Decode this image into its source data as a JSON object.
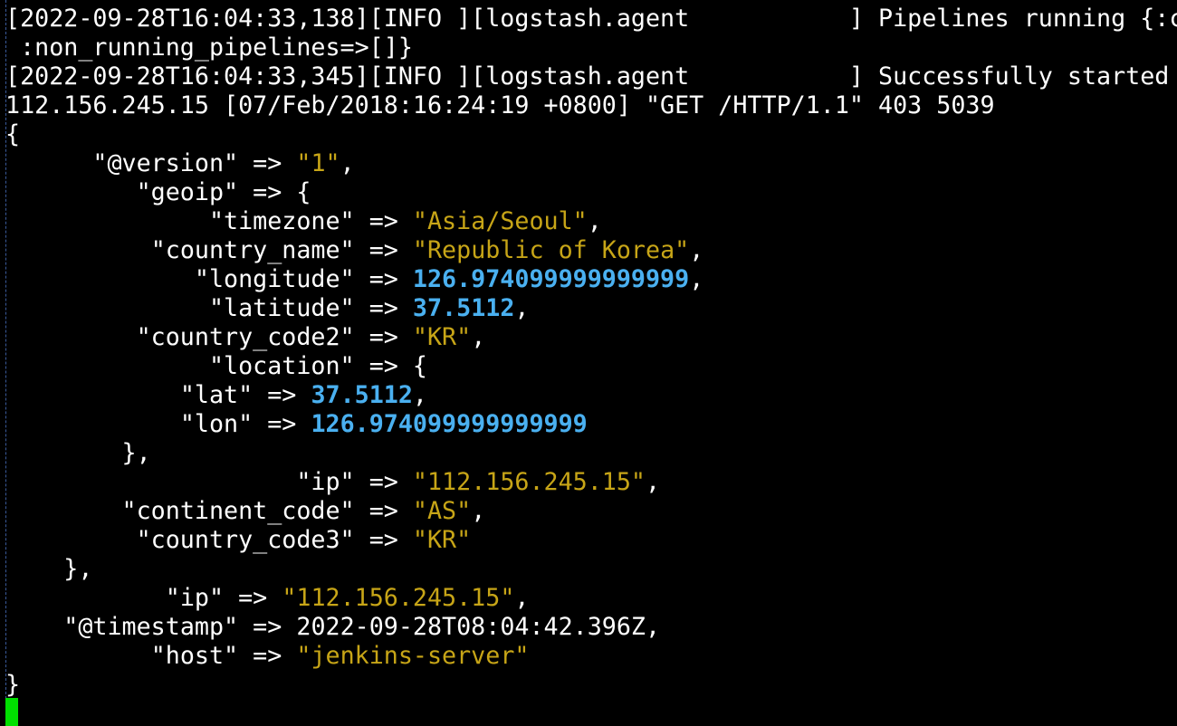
{
  "terminal": {
    "log_lines": [
      "[2022-09-28T16:04:33,138][INFO ][logstash.agent           ] Pipelines running {:c",
      " :non_running_pipelines=>[]}",
      "[2022-09-28T16:04:33,345][INFO ][logstash.agent           ] Successfully started",
      "112.156.245.15 [07/Feb/2018:16:24:19 +0800] \"GET /HTTP/1.1\" 403 5039"
    ],
    "open_brace": "{",
    "close_brace": "}",
    "arrow": " => ",
    "geoip_close": "},",
    "location_close": "},",
    "rubydebug": [
      {
        "indent": "      ",
        "key": "\"@version\"",
        "value": "\"1\"",
        "type": "str",
        "suffix": ","
      },
      {
        "indent": "         ",
        "key": "\"geoip\"",
        "value": "{",
        "type": "plain",
        "suffix": ""
      },
      {
        "indent": "              ",
        "key": "\"timezone\"",
        "value": "\"Asia/Seoul\"",
        "type": "str",
        "suffix": ","
      },
      {
        "indent": "          ",
        "key": "\"country_name\"",
        "value": "\"Republic of Korea\"",
        "type": "str",
        "suffix": ","
      },
      {
        "indent": "             ",
        "key": "\"longitude\"",
        "value": "126.974099999999999",
        "type": "num",
        "suffix": ","
      },
      {
        "indent": "              ",
        "key": "\"latitude\"",
        "value": "37.5112",
        "type": "num",
        "suffix": ","
      },
      {
        "indent": "         ",
        "key": "\"country_code2\"",
        "value": "\"KR\"",
        "type": "str",
        "suffix": ","
      },
      {
        "indent": "              ",
        "key": "\"location\"",
        "value": "{",
        "type": "plain",
        "suffix": ""
      },
      {
        "indent": "            ",
        "key": "\"lat\"",
        "value": "37.5112",
        "type": "num",
        "suffix": ","
      },
      {
        "indent": "            ",
        "key": "\"lon\"",
        "value": "126.974099999999999",
        "type": "num",
        "suffix": ""
      },
      {
        "indent": "        ",
        "key": "",
        "value": "",
        "type": "close",
        "suffix": "},"
      },
      {
        "indent": "                    ",
        "key": "\"ip\"",
        "value": "\"112.156.245.15\"",
        "type": "str",
        "suffix": ","
      },
      {
        "indent": "        ",
        "key": "\"continent_code\"",
        "value": "\"AS\"",
        "type": "str",
        "suffix": ","
      },
      {
        "indent": "         ",
        "key": "\"country_code3\"",
        "value": "\"KR\"",
        "type": "str",
        "suffix": ""
      },
      {
        "indent": "    ",
        "key": "",
        "value": "",
        "type": "close",
        "suffix": "},"
      },
      {
        "indent": "           ",
        "key": "\"ip\"",
        "value": "\"112.156.245.15\"",
        "type": "str",
        "suffix": ","
      },
      {
        "indent": "    ",
        "key": "\"@timestamp\"",
        "value": "2022-09-28T08:04:42.396Z",
        "type": "plain",
        "suffix": ","
      },
      {
        "indent": "          ",
        "key": "\"host\"",
        "value": "\"jenkins-server\"",
        "type": "str",
        "suffix": ""
      }
    ],
    "colors": {
      "background": "#000000",
      "text": "#ffffff",
      "string": "#c7a517",
      "number": "#4ab0f0",
      "cursor": "#00e000"
    }
  }
}
